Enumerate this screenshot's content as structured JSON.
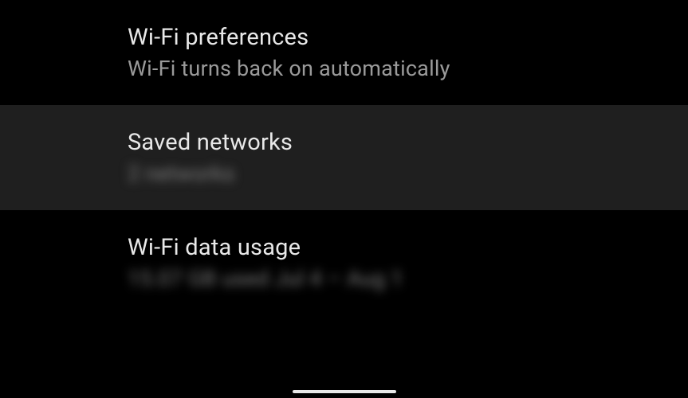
{
  "settings": {
    "items": [
      {
        "title": "Wi-Fi preferences",
        "subtitle": "Wi-Fi turns back on automatically",
        "highlighted": false,
        "blurred": false
      },
      {
        "title": "Saved networks",
        "subtitle": "2 networks",
        "highlighted": true,
        "blurred": true
      },
      {
        "title": "Wi-Fi data usage",
        "subtitle": "15.07 GB used Jul 4 – Aug 1",
        "highlighted": false,
        "blurred": true
      }
    ]
  }
}
